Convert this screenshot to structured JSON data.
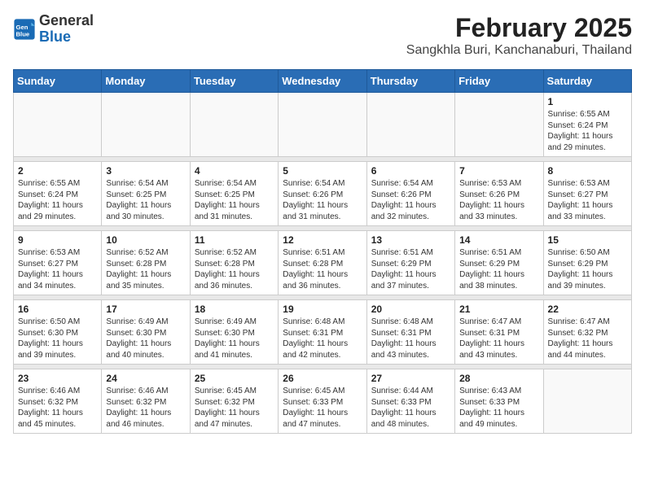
{
  "header": {
    "logo_line1": "General",
    "logo_line2": "Blue",
    "title": "February 2025",
    "subtitle": "Sangkhla Buri, Kanchanaburi, Thailand"
  },
  "calendar": {
    "days_of_week": [
      "Sunday",
      "Monday",
      "Tuesday",
      "Wednesday",
      "Thursday",
      "Friday",
      "Saturday"
    ],
    "weeks": [
      [
        {
          "day": "",
          "info": ""
        },
        {
          "day": "",
          "info": ""
        },
        {
          "day": "",
          "info": ""
        },
        {
          "day": "",
          "info": ""
        },
        {
          "day": "",
          "info": ""
        },
        {
          "day": "",
          "info": ""
        },
        {
          "day": "1",
          "info": "Sunrise: 6:55 AM\nSunset: 6:24 PM\nDaylight: 11 hours\nand 29 minutes."
        }
      ],
      [
        {
          "day": "2",
          "info": "Sunrise: 6:55 AM\nSunset: 6:24 PM\nDaylight: 11 hours\nand 29 minutes."
        },
        {
          "day": "3",
          "info": "Sunrise: 6:54 AM\nSunset: 6:25 PM\nDaylight: 11 hours\nand 30 minutes."
        },
        {
          "day": "4",
          "info": "Sunrise: 6:54 AM\nSunset: 6:25 PM\nDaylight: 11 hours\nand 31 minutes."
        },
        {
          "day": "5",
          "info": "Sunrise: 6:54 AM\nSunset: 6:26 PM\nDaylight: 11 hours\nand 31 minutes."
        },
        {
          "day": "6",
          "info": "Sunrise: 6:54 AM\nSunset: 6:26 PM\nDaylight: 11 hours\nand 32 minutes."
        },
        {
          "day": "7",
          "info": "Sunrise: 6:53 AM\nSunset: 6:26 PM\nDaylight: 11 hours\nand 33 minutes."
        },
        {
          "day": "8",
          "info": "Sunrise: 6:53 AM\nSunset: 6:27 PM\nDaylight: 11 hours\nand 33 minutes."
        }
      ],
      [
        {
          "day": "9",
          "info": "Sunrise: 6:53 AM\nSunset: 6:27 PM\nDaylight: 11 hours\nand 34 minutes."
        },
        {
          "day": "10",
          "info": "Sunrise: 6:52 AM\nSunset: 6:28 PM\nDaylight: 11 hours\nand 35 minutes."
        },
        {
          "day": "11",
          "info": "Sunrise: 6:52 AM\nSunset: 6:28 PM\nDaylight: 11 hours\nand 36 minutes."
        },
        {
          "day": "12",
          "info": "Sunrise: 6:51 AM\nSunset: 6:28 PM\nDaylight: 11 hours\nand 36 minutes."
        },
        {
          "day": "13",
          "info": "Sunrise: 6:51 AM\nSunset: 6:29 PM\nDaylight: 11 hours\nand 37 minutes."
        },
        {
          "day": "14",
          "info": "Sunrise: 6:51 AM\nSunset: 6:29 PM\nDaylight: 11 hours\nand 38 minutes."
        },
        {
          "day": "15",
          "info": "Sunrise: 6:50 AM\nSunset: 6:29 PM\nDaylight: 11 hours\nand 39 minutes."
        }
      ],
      [
        {
          "day": "16",
          "info": "Sunrise: 6:50 AM\nSunset: 6:30 PM\nDaylight: 11 hours\nand 39 minutes."
        },
        {
          "day": "17",
          "info": "Sunrise: 6:49 AM\nSunset: 6:30 PM\nDaylight: 11 hours\nand 40 minutes."
        },
        {
          "day": "18",
          "info": "Sunrise: 6:49 AM\nSunset: 6:30 PM\nDaylight: 11 hours\nand 41 minutes."
        },
        {
          "day": "19",
          "info": "Sunrise: 6:48 AM\nSunset: 6:31 PM\nDaylight: 11 hours\nand 42 minutes."
        },
        {
          "day": "20",
          "info": "Sunrise: 6:48 AM\nSunset: 6:31 PM\nDaylight: 11 hours\nand 43 minutes."
        },
        {
          "day": "21",
          "info": "Sunrise: 6:47 AM\nSunset: 6:31 PM\nDaylight: 11 hours\nand 43 minutes."
        },
        {
          "day": "22",
          "info": "Sunrise: 6:47 AM\nSunset: 6:32 PM\nDaylight: 11 hours\nand 44 minutes."
        }
      ],
      [
        {
          "day": "23",
          "info": "Sunrise: 6:46 AM\nSunset: 6:32 PM\nDaylight: 11 hours\nand 45 minutes."
        },
        {
          "day": "24",
          "info": "Sunrise: 6:46 AM\nSunset: 6:32 PM\nDaylight: 11 hours\nand 46 minutes."
        },
        {
          "day": "25",
          "info": "Sunrise: 6:45 AM\nSunset: 6:32 PM\nDaylight: 11 hours\nand 47 minutes."
        },
        {
          "day": "26",
          "info": "Sunrise: 6:45 AM\nSunset: 6:33 PM\nDaylight: 11 hours\nand 47 minutes."
        },
        {
          "day": "27",
          "info": "Sunrise: 6:44 AM\nSunset: 6:33 PM\nDaylight: 11 hours\nand 48 minutes."
        },
        {
          "day": "28",
          "info": "Sunrise: 6:43 AM\nSunset: 6:33 PM\nDaylight: 11 hours\nand 49 minutes."
        },
        {
          "day": "",
          "info": ""
        }
      ]
    ]
  }
}
